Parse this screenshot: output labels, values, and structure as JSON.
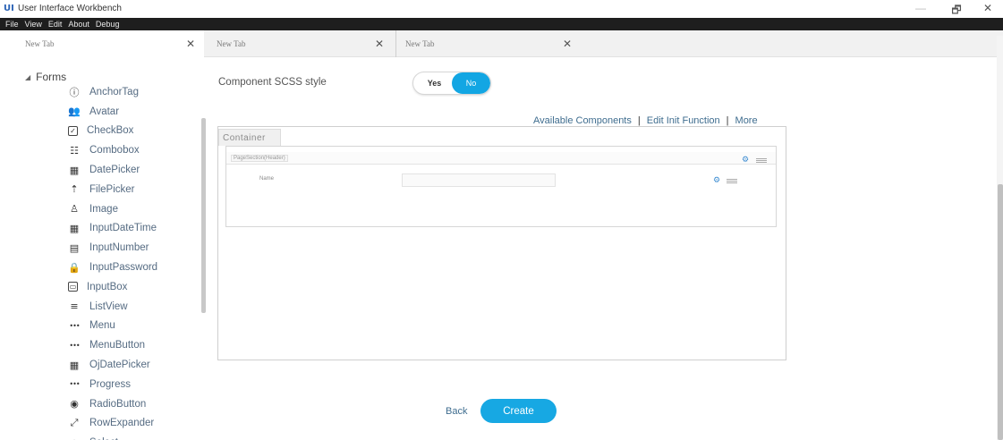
{
  "window": {
    "logo": "UI",
    "title": "User Interface Workbench",
    "minimize_glyph": "—",
    "maximize_glyph": "🗗",
    "close_glyph": "✕"
  },
  "menu": [
    "File",
    "View",
    "Edit",
    "About",
    "Debug"
  ],
  "tabs": [
    {
      "label": "New Tab",
      "close": "✕"
    },
    {
      "label": "New Tab",
      "close": "✕"
    },
    {
      "label": "New Tab",
      "close": "✕"
    }
  ],
  "sidebar": {
    "group_caret": "◢",
    "group_label": "Forms",
    "items": [
      {
        "label": "AnchorTag",
        "icon": "info-circle-icon",
        "glyph": "ⓘ"
      },
      {
        "label": "Avatar",
        "icon": "avatar-icon",
        "glyph": "👥"
      },
      {
        "label": "CheckBox",
        "icon": "checkbox-icon",
        "glyph": "✓"
      },
      {
        "label": "Combobox",
        "icon": "combobox-icon",
        "glyph": "☷"
      },
      {
        "label": "DatePicker",
        "icon": "calendar-icon",
        "glyph": "▦"
      },
      {
        "label": "FilePicker",
        "icon": "upload-icon",
        "glyph": "⇡"
      },
      {
        "label": "Image",
        "icon": "image-person-icon",
        "glyph": "♙"
      },
      {
        "label": "InputDateTime",
        "icon": "calendar-time-icon",
        "glyph": "▦"
      },
      {
        "label": "InputNumber",
        "icon": "number-icon",
        "glyph": "▤"
      },
      {
        "label": "InputPassword",
        "icon": "lock-icon",
        "glyph": "🔒"
      },
      {
        "label": "InputBox",
        "icon": "input-box-icon",
        "glyph": "▭"
      },
      {
        "label": "ListView",
        "icon": "list-icon",
        "glyph": "≡"
      },
      {
        "label": "Menu",
        "icon": "more-dots-icon",
        "glyph": "•••"
      },
      {
        "label": "MenuButton",
        "icon": "more-dots-icon",
        "glyph": "•••"
      },
      {
        "label": "OjDatePicker",
        "icon": "grid-calendar-icon",
        "glyph": "▦"
      },
      {
        "label": "Progress",
        "icon": "more-dots-icon",
        "glyph": "•••"
      },
      {
        "label": "RadioButton",
        "icon": "radio-icon",
        "glyph": "◉"
      },
      {
        "label": "RowExpander",
        "icon": "expand-icon",
        "glyph": "⤢"
      },
      {
        "label": "Select",
        "icon": "select-icon",
        "glyph": "○"
      }
    ]
  },
  "main": {
    "scss_label": "Component SCSS style",
    "toggle": {
      "yes": "Yes",
      "no": "No",
      "selected": "No"
    },
    "links": [
      "Available Components",
      "Edit Init Function",
      "More"
    ],
    "link_separator": "|",
    "container_tab": "Container",
    "section_label": "PageSection(Header)",
    "name_label": "Name",
    "name_value": "",
    "gear_glyph": "⚙",
    "back": "Back",
    "create": "Create"
  },
  "colors": {
    "accent": "#17a8e3",
    "link": "#3f6d8f",
    "menubar": "#1e1e1e"
  }
}
